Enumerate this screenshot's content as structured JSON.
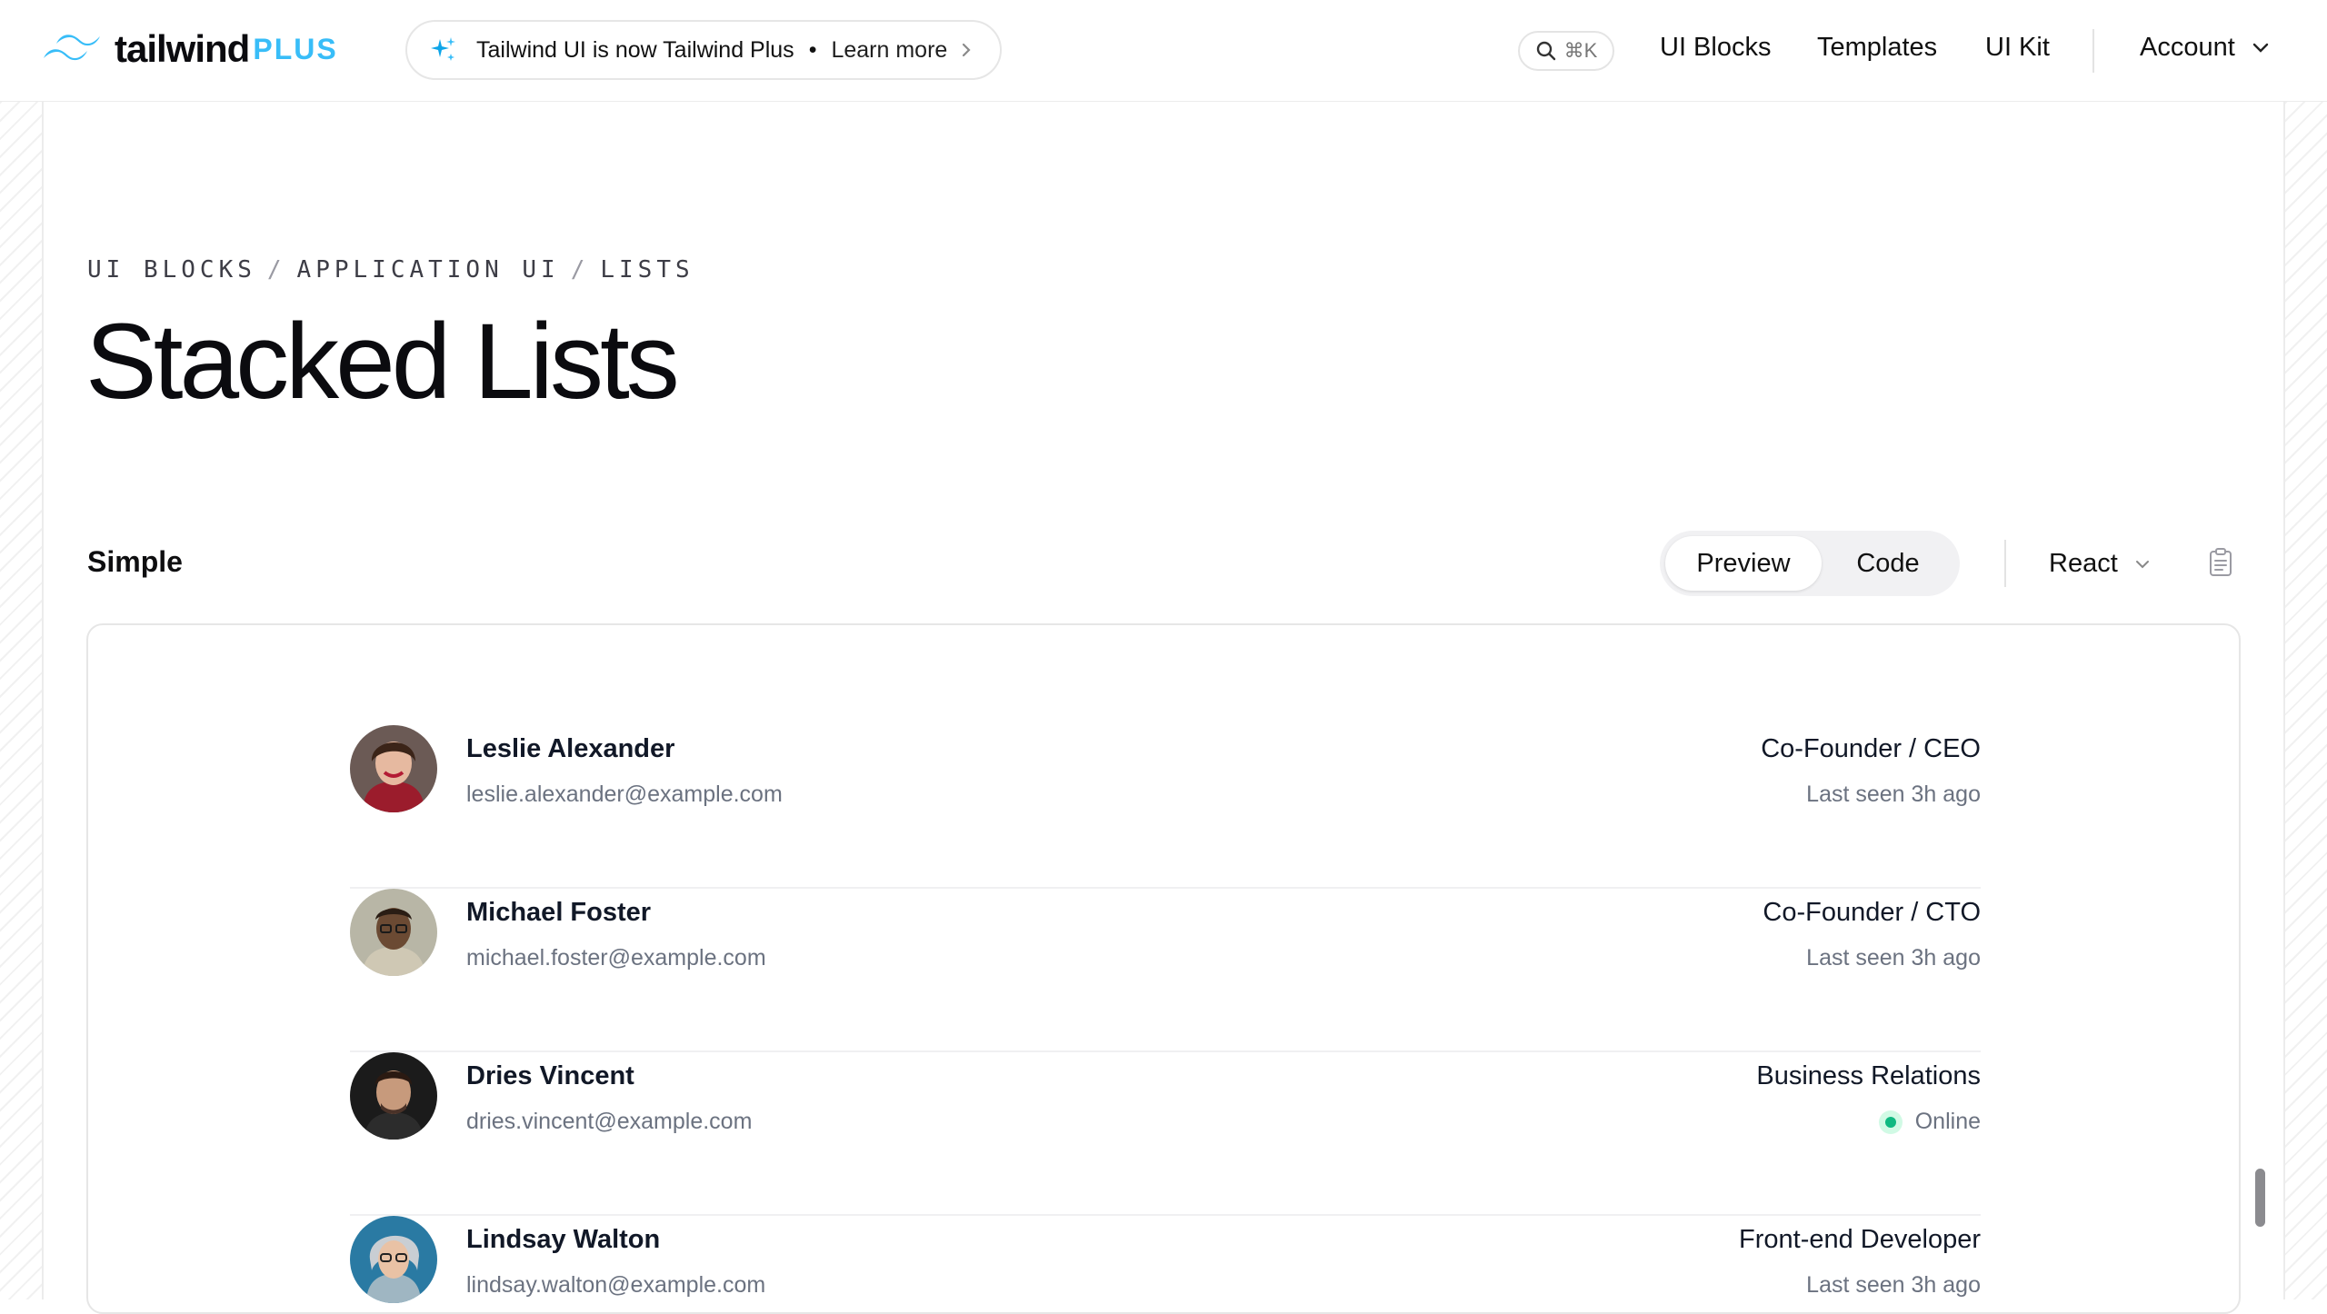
{
  "header": {
    "logo_wordmark": "tailwind",
    "logo_plus": "PLUS",
    "announcement": {
      "text": "Tailwind UI is now Tailwind Plus",
      "separator": "•",
      "link": "Learn more"
    },
    "search_shortcut": "⌘K",
    "nav": [
      "UI Blocks",
      "Templates",
      "UI Kit"
    ],
    "account": "Account"
  },
  "breadcrumb": [
    "UI BLOCKS",
    "APPLICATION UI",
    "LISTS"
  ],
  "breadcrumb_separator": "/",
  "page_title": "Stacked Lists",
  "section": {
    "title": "Simple",
    "toggle": [
      "Preview",
      "Code"
    ],
    "framework": "React"
  },
  "people": [
    {
      "name": "Leslie Alexander",
      "email": "leslie.alexander@example.com",
      "role": "Co-Founder / CEO",
      "status": "Last seen 3h ago",
      "online": false
    },
    {
      "name": "Michael Foster",
      "email": "michael.foster@example.com",
      "role": "Co-Founder / CTO",
      "status": "Last seen 3h ago",
      "online": false
    },
    {
      "name": "Dries Vincent",
      "email": "dries.vincent@example.com",
      "role": "Business Relations",
      "status": "Online",
      "online": true
    },
    {
      "name": "Lindsay Walton",
      "email": "lindsay.walton@example.com",
      "role": "Front-end Developer",
      "status": "Last seen 3h ago",
      "online": false
    }
  ],
  "colors": {
    "brand_accent": "#38bdf8",
    "online_green": "#10b981"
  }
}
